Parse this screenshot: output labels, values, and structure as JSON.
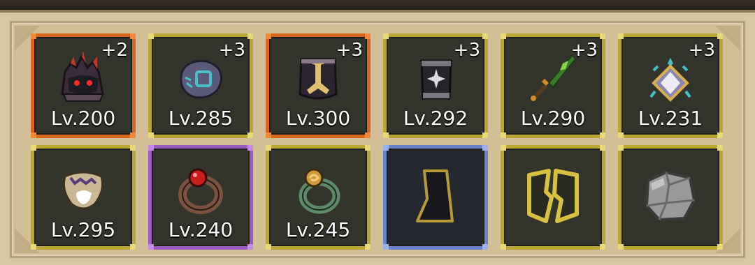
{
  "equipment": {
    "rows": [
      [
        {
          "rarity": "orange",
          "plus": "+2",
          "level": "Lv.200",
          "icon": "dark-helmet-icon"
        },
        {
          "rarity": "yellow",
          "plus": "+3",
          "level": "Lv.285",
          "icon": "stone-gauntlet-icon"
        },
        {
          "rarity": "orange",
          "plus": "+3",
          "level": "Lv.300",
          "icon": "chest-armor-icon"
        },
        {
          "rarity": "yellow",
          "plus": "+3",
          "level": "Lv.292",
          "icon": "bracer-icon"
        },
        {
          "rarity": "yellow",
          "plus": "+3",
          "level": "Lv.290",
          "icon": "green-dagger-icon"
        },
        {
          "rarity": "yellow",
          "plus": "+3",
          "level": "Lv.231",
          "icon": "amulet-icon"
        }
      ],
      [
        {
          "rarity": "yellow",
          "plus": "",
          "level": "Lv.295",
          "icon": "bone-necklace-icon"
        },
        {
          "rarity": "purple",
          "plus": "",
          "level": "Lv.240",
          "icon": "ruby-ring-icon"
        },
        {
          "rarity": "yellow",
          "plus": "",
          "level": "Lv.245",
          "icon": "jade-ring-icon"
        },
        {
          "rarity": "blue",
          "plus": "",
          "level": "",
          "icon": "cloak-slot-icon"
        },
        {
          "rarity": "yellow",
          "plus": "",
          "level": "",
          "icon": "broken-shield-slot-icon"
        },
        {
          "rarity": "yellow",
          "plus": "",
          "level": "",
          "icon": "stone-slot-icon"
        }
      ]
    ]
  },
  "colors": {
    "orange_frame": "#d9661b",
    "yellow_frame": "#b9a82f",
    "purple_frame": "#9b5cc0",
    "blue_frame": "#6a83c8",
    "slot_background": "#33352d",
    "panel_background": "#d2bf98"
  }
}
